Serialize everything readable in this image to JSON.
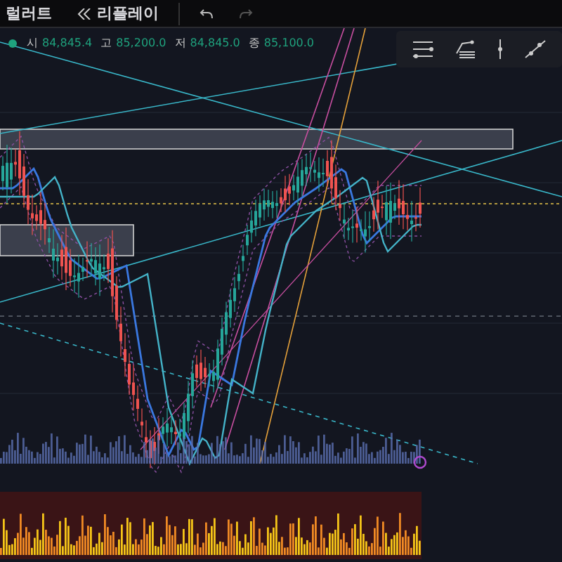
{
  "top_bar": {
    "items": [
      {
        "label": "럴러트",
        "kind": "plain"
      },
      {
        "label": "리플레이",
        "kind": "replay"
      }
    ]
  },
  "legend": {
    "fields": [
      {
        "label": "시",
        "value": "84,845.4"
      },
      {
        "label": "고",
        "value": "85,200.0"
      },
      {
        "label": "저",
        "value": "84,845.0"
      },
      {
        "label": "종",
        "value": "85,100.0"
      }
    ]
  }
}
